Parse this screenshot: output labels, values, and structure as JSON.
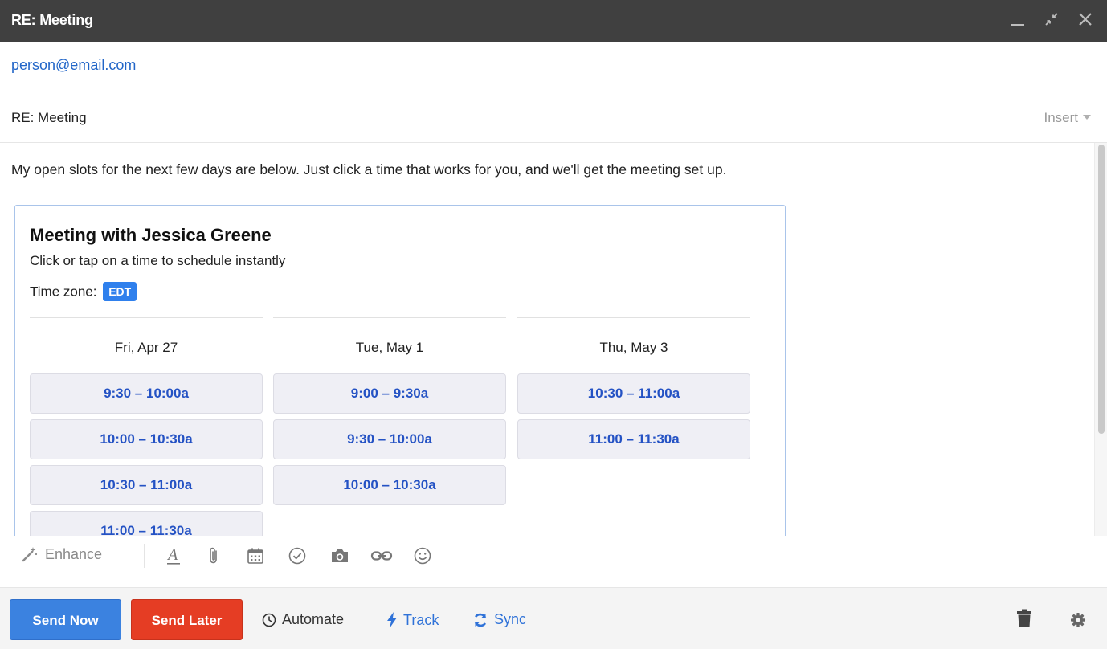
{
  "window": {
    "title": "RE: Meeting",
    "controls": {
      "minimize": "_",
      "close": "✕"
    }
  },
  "compose": {
    "to": "person@email.com",
    "subject": "RE: Meeting",
    "insert_label": "Insert",
    "intro_text": "My open slots for the next few days are below. Just click a time that works for you, and we'll get the meeting set up."
  },
  "scheduler": {
    "title": "Meeting with Jessica Greene",
    "subtitle": "Click or tap on a time to schedule instantly",
    "timezone_label": "Time zone:",
    "timezone": "EDT",
    "days": [
      {
        "label": "Fri, Apr 27",
        "slots": [
          "9:30 – 10:00a",
          "10:00 – 10:30a",
          "10:30 – 11:00a",
          "11:00 – 11:30a"
        ]
      },
      {
        "label": "Tue, May 1",
        "slots": [
          "9:00 – 9:30a",
          "9:30 – 10:00a",
          "10:00 – 10:30a"
        ]
      },
      {
        "label": "Thu, May 3",
        "slots": [
          "10:30 – 11:00a",
          "11:00 – 11:30a"
        ]
      }
    ]
  },
  "format_bar": {
    "enhance_label": "Enhance",
    "icons": [
      "text-format-icon",
      "attachment-icon",
      "calendar-icon",
      "checkmark-icon",
      "camera-icon",
      "link-icon",
      "emoji-icon"
    ]
  },
  "actions": {
    "send_now": "Send Now",
    "send_later": "Send Later",
    "automate": "Automate",
    "track": "Track",
    "sync": "Sync"
  },
  "colors": {
    "titlebar": "#404040",
    "link_blue": "#2266c8",
    "accent_blue": "#3b82e0",
    "send_later_red": "#e53d24",
    "slot_text": "#2452c4",
    "timezone_badge": "#2f80ed"
  }
}
